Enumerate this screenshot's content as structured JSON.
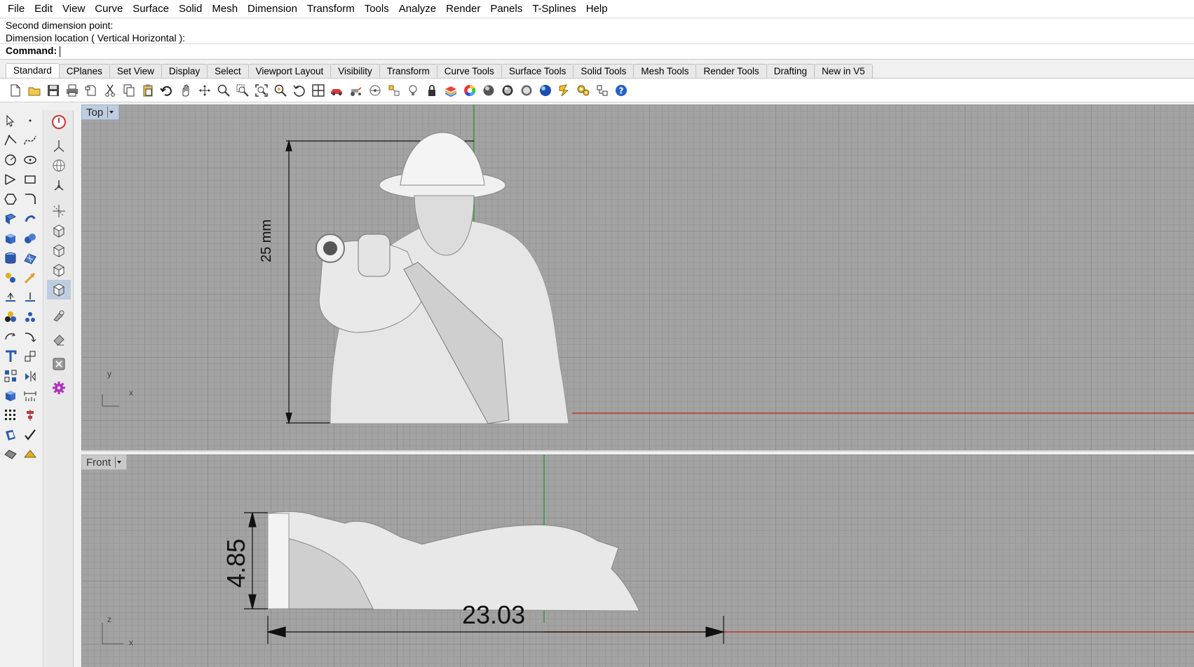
{
  "menu": [
    "File",
    "Edit",
    "View",
    "Curve",
    "Surface",
    "Solid",
    "Mesh",
    "Dimension",
    "Transform",
    "Tools",
    "Analyze",
    "Render",
    "Panels",
    "T-Splines",
    "Help"
  ],
  "command": {
    "history": [
      "Second dimension point:",
      "Dimension location ( Vertical  Horizontal ):"
    ],
    "prompt_label": "Command:",
    "input_value": ""
  },
  "tabs": [
    "Standard",
    "CPlanes",
    "Set View",
    "Display",
    "Select",
    "Viewport Layout",
    "Visibility",
    "Transform",
    "Curve Tools",
    "Surface Tools",
    "Solid Tools",
    "Mesh Tools",
    "Render Tools",
    "Drafting",
    "New in V5"
  ],
  "active_tab": "Standard",
  "toolbar_icons": [
    "new-icon",
    "open-icon",
    "save-icon",
    "print-icon",
    "import-icon",
    "cut-icon",
    "copy-icon",
    "paste-icon",
    "undo-icon",
    "pan-icon",
    "rotate-view-icon",
    "zoom-icon",
    "zoom-window-icon",
    "zoom-extents-icon",
    "zoom-selected-icon",
    "undo-view-icon",
    "viewport-layout-icon",
    "car-icon",
    "tractor-icon",
    "cplane-icon",
    "grid-snap-icon",
    "lightbulb-icon",
    "lock-icon",
    "layers-icon",
    "color-wheel-icon",
    "shaded-icon",
    "rendered-icon",
    "ghosted-icon",
    "render-sphere-icon",
    "lasso-icon",
    "settings-icon",
    "dimension-icon",
    "help-icon"
  ],
  "viewports": {
    "top": {
      "label": "Top",
      "dimension_label": "25 mm",
      "axis_x": "x",
      "axis_y": "y"
    },
    "front": {
      "label": "Front",
      "dimension_height": "4.85",
      "dimension_width": "23.03",
      "axis_x": "x",
      "axis_z": "z"
    }
  },
  "colors": {
    "x_axis": "#c0392b",
    "y_axis": "#2e9e3a",
    "viewport_bg": "#a3a3a3",
    "active_label": "#bfcde0"
  }
}
